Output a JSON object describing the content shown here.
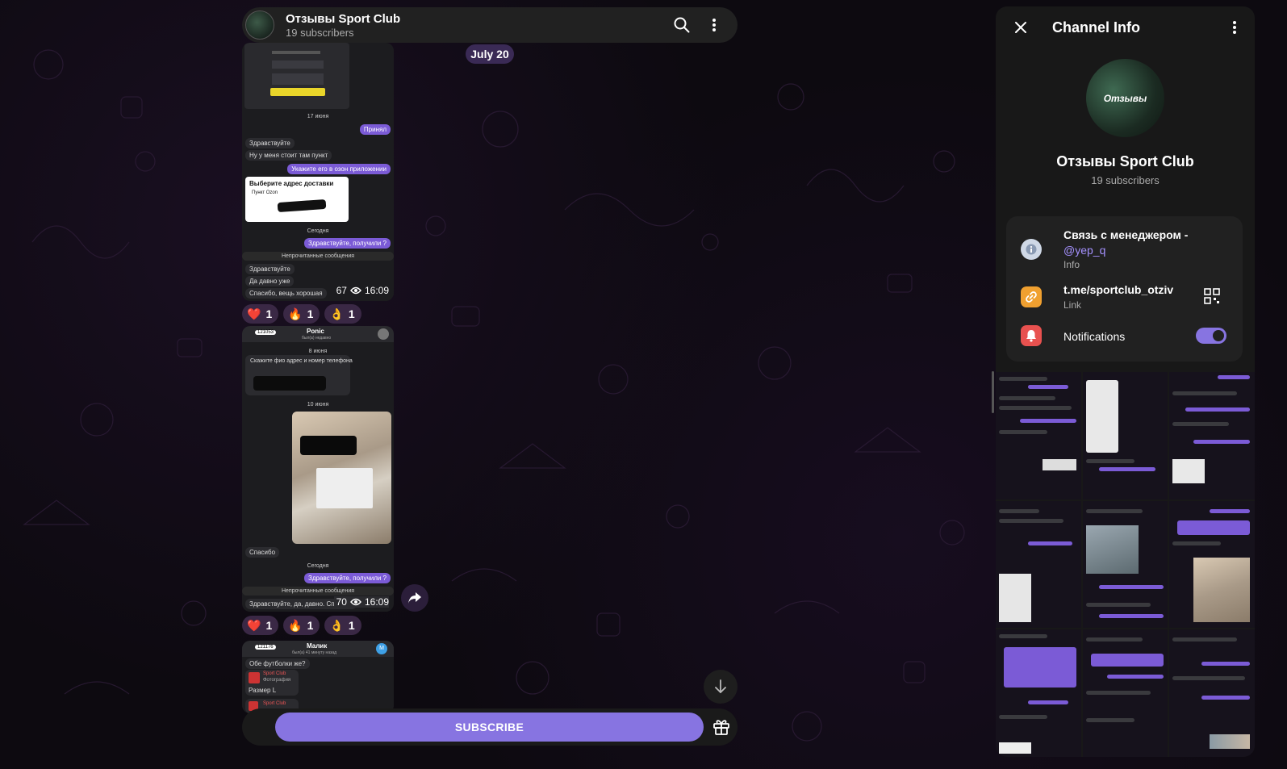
{
  "header": {
    "title": "Отзывы Sport Club",
    "subtitle": "19 subscribers"
  },
  "date_pill": "July 20",
  "post1": {
    "screenshot_texts": {
      "day_label": "17 июня",
      "out_accept": "Принял",
      "in_hello": "Здравствуйте",
      "in_point": "Ну у меня стоит там пункт",
      "out_app": "Укажите его в озон приложении",
      "card_title": "Выберите адрес доставки",
      "card_option": "Пункт Ozon",
      "today": "Сегодня",
      "out_received": "Здравствуйте, получили ?",
      "unread": "Непрочитанные сообщения",
      "in_hello2": "Здравствуйте",
      "in_long": "Да давно уже",
      "in_thanks": "Спасибо, вещь хорошая"
    },
    "views": "67",
    "time": "16:09",
    "reactions": [
      {
        "emoji": "❤️",
        "count": "1"
      },
      {
        "emoji": "🔥",
        "count": "1"
      },
      {
        "emoji": "👌",
        "count": "1"
      }
    ]
  },
  "post2": {
    "screenshot_texts": {
      "badge": "121053",
      "name": "Ponic",
      "last_seen": "был(а) недавно",
      "day1": "8 июня",
      "q": "Скажите фио адрес и номер телефона",
      "day2": "10 июня",
      "in_thanks": "Спасибо",
      "today": "Сегодня",
      "out_received": "Здравствуйте, получили ?",
      "unread": "Непрочитанные сообщения",
      "in_reply": "Здравствуйте, да, давно. Спасибо"
    },
    "views": "70",
    "time": "16:09",
    "reactions": [
      {
        "emoji": "❤️",
        "count": "1"
      },
      {
        "emoji": "🔥",
        "count": "1"
      },
      {
        "emoji": "👌",
        "count": "1"
      }
    ]
  },
  "post3": {
    "screenshot_texts": {
      "badge": "121176",
      "name": "Малик",
      "last_seen": "был(а) 41 минуту назад",
      "q": "Обе футболки же?",
      "fwd_name": "Sport Club",
      "fwd_sub": "Фотография",
      "size": "Размер L",
      "fwd_name2": "Sport Club",
      "avatar_letter": "М"
    }
  },
  "subscribe_label": "SUBSCRIBE",
  "panel": {
    "title": "Channel Info",
    "avatar_text": "Отзывы",
    "name": "Отзывы Sport Club",
    "subscribers": "19 subscribers",
    "info_text": "Связь с менеджером -",
    "info_link": "@yep_q",
    "info_label": "Info",
    "link_text": "t.me/sportclub_otziv",
    "link_label": "Link",
    "notifications_label": "Notifications",
    "notifications_on": true
  },
  "colors": {
    "accent": "#8774e1",
    "bubble_out": "#7b5bd6",
    "link": "#a591ff",
    "panel_bg": "#181818",
    "card_bg": "#212121"
  },
  "icons": {
    "search": "search-icon",
    "more": "more-vertical-icon",
    "close": "close-icon",
    "info": "info-icon",
    "link": "link-icon",
    "qr": "qr-code-icon",
    "bell": "bell-icon",
    "share": "share-icon",
    "down": "arrow-down-icon",
    "gift": "gift-icon",
    "views": "eye-icon"
  }
}
